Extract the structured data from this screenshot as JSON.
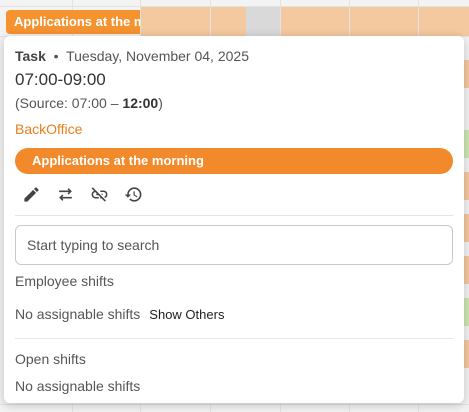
{
  "background": {
    "event_label": "Applications at the m",
    "accent_color": "#f59331",
    "strip_color": "#f5c9a0",
    "side_green": "#cfe6b3"
  },
  "popover": {
    "task_type": "Task",
    "date": "Tuesday, November 04, 2025",
    "time_range": "07:00-09:00",
    "source_prefix": "(Source: 07:00 – ",
    "source_end": "12:00",
    "source_suffix": ")",
    "department": "BackOffice",
    "task_name": "Applications at the morning",
    "actions": [
      {
        "icon": "pencil-icon",
        "label": "Edit"
      },
      {
        "icon": "swap-icon",
        "label": "Swap"
      },
      {
        "icon": "unlink-icon",
        "label": "Unlink"
      },
      {
        "icon": "history-icon",
        "label": "History"
      }
    ],
    "search": {
      "placeholder": "Start typing to search"
    },
    "employee_shifts": {
      "title": "Employee shifts",
      "empty": "No assignable shifts",
      "show_others": "Show Others"
    },
    "open_shifts": {
      "title": "Open shifts",
      "empty": "No assignable shifts"
    }
  }
}
